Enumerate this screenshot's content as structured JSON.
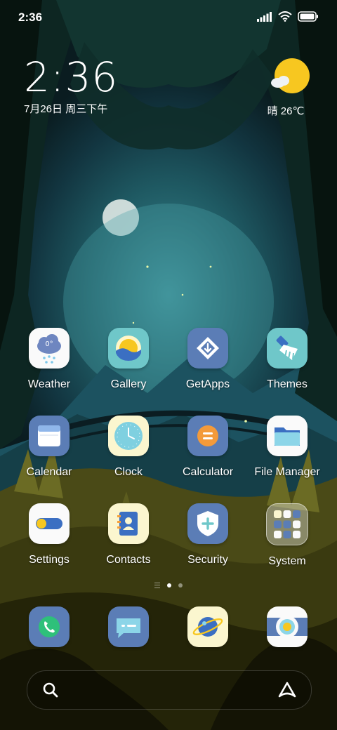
{
  "status_bar": {
    "time": "2:36",
    "icons": [
      "signal-icon",
      "wifi-icon",
      "battery-icon"
    ]
  },
  "clock_widget": {
    "time": "2:36",
    "date": "7月26日 周三下午"
  },
  "weather_widget": {
    "text": "晴 26℃",
    "icon": "sun-cloud-icon"
  },
  "apps": [
    {
      "label": "Weather",
      "icon": "weather-icon"
    },
    {
      "label": "Gallery",
      "icon": "gallery-icon"
    },
    {
      "label": "GetApps",
      "icon": "getapps-icon"
    },
    {
      "label": "Themes",
      "icon": "themes-brush-icon"
    },
    {
      "label": "Calendar",
      "icon": "calendar-icon"
    },
    {
      "label": "Clock",
      "icon": "clock-icon"
    },
    {
      "label": "Calculator",
      "icon": "calculator-icon"
    },
    {
      "label": "File Manager",
      "icon": "folder-icon"
    },
    {
      "label": "Settings",
      "icon": "toggle-icon"
    },
    {
      "label": "Contacts",
      "icon": "contacts-book-icon"
    },
    {
      "label": "Security",
      "icon": "shield-plus-icon"
    },
    {
      "label": "System",
      "icon": "folder-grid-icon"
    }
  ],
  "weather_icon_text": "0°",
  "pages": {
    "count": 2,
    "current": 1
  },
  "dock": [
    {
      "name": "phone",
      "icon": "phone-icon"
    },
    {
      "name": "messages",
      "icon": "message-icon"
    },
    {
      "name": "browser",
      "icon": "browser-planet-icon"
    },
    {
      "name": "camera",
      "icon": "camera-icon"
    }
  ],
  "search_bar": {
    "left_icon": "search-icon",
    "right_icon": "assistant-icon"
  },
  "colors": {
    "icon_blue": "#5b7db6",
    "icon_cream": "#fbf6cf",
    "icon_white": "#fafafa",
    "teal": "#6fc7c9"
  }
}
